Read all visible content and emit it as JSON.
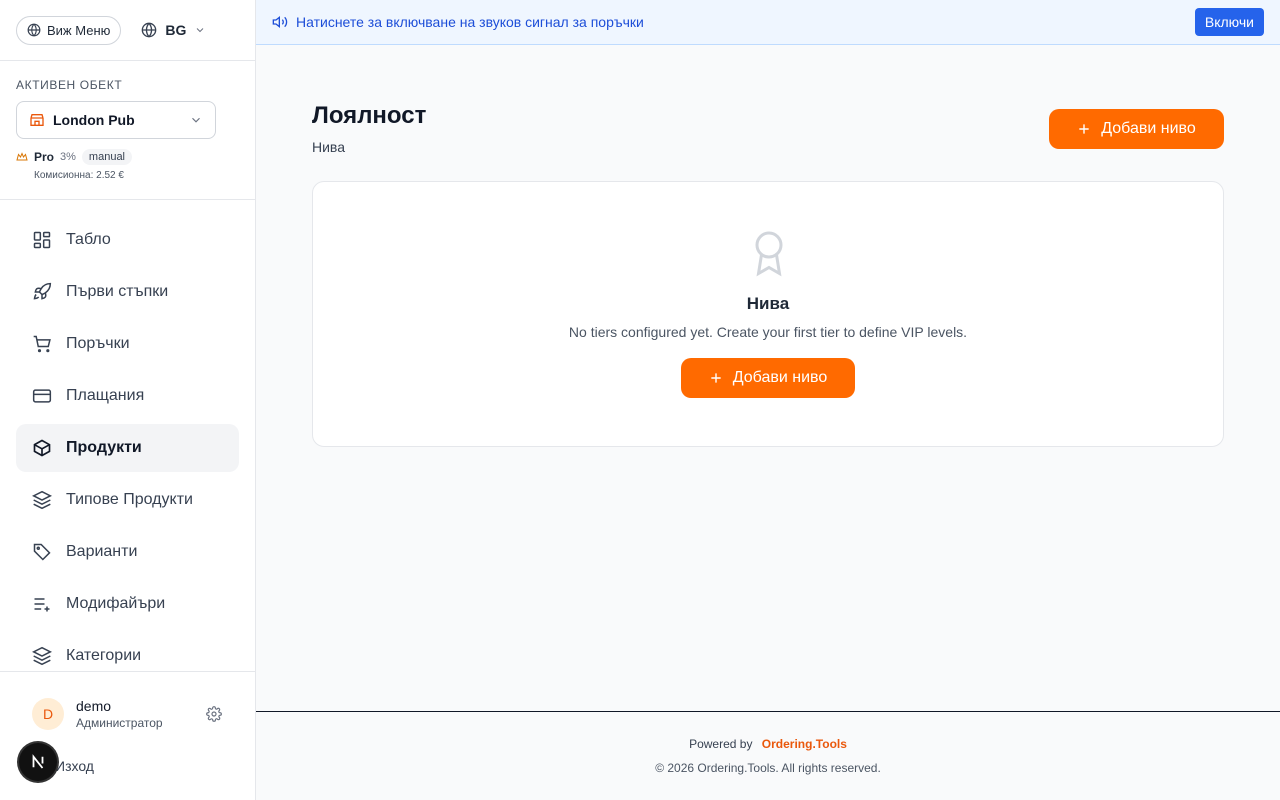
{
  "sidebar": {
    "menu_button_label": "Виж Меню",
    "language": "BG",
    "venue_label": "АКТИВЕН ОБЕКТ",
    "venue_name": "London Pub",
    "plan_name": "Pro",
    "plan_percent": "3%",
    "plan_badge": "manual",
    "commission": "Комисионна: 2.52 €",
    "nav_items": [
      {
        "label": "Табло",
        "icon": "dashboard-icon"
      },
      {
        "label": "Първи стъпки",
        "icon": "rocket-icon"
      },
      {
        "label": "Поръчки",
        "icon": "cart-icon"
      },
      {
        "label": "Плащания",
        "icon": "credit-card-icon"
      },
      {
        "label": "Продукти",
        "icon": "box-icon",
        "active": true
      },
      {
        "label": "Типове Продукти",
        "icon": "layers-icon"
      },
      {
        "label": "Варианти",
        "icon": "tag-icon"
      },
      {
        "label": "Модифайъри",
        "icon": "list-plus-icon"
      },
      {
        "label": "Категории",
        "icon": "layers-icon"
      }
    ],
    "user": {
      "initial": "D",
      "name": "demo",
      "role": "Администратор",
      "logout": "Изход"
    }
  },
  "banner": {
    "text": "Натиснете за включване на звуков сигнал за поръчки",
    "button": "Включи"
  },
  "main": {
    "title": "Лоялност",
    "subtitle": "Нива",
    "add_button": "Добави ниво",
    "empty": {
      "title": "Нива",
      "text": "No tiers configured yet. Create your first tier to define VIP levels.",
      "button": "Добави ниво"
    }
  },
  "footer": {
    "powered_by": "Powered by",
    "brand": "Ordering.Tools",
    "copyright": "© 2026 Ordering.Tools. All rights reserved."
  },
  "colors": {
    "accent": "#ff6a00",
    "banner_bg": "#eff6ff",
    "banner_button": "#2563eb"
  }
}
